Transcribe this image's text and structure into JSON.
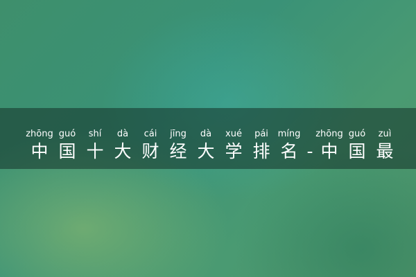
{
  "title": {
    "pinyin": [
      "zhōng",
      "guó",
      "shí",
      "dà",
      "cái",
      "jīng",
      "dà",
      "xué",
      "pái",
      "míng",
      "",
      "zhōng",
      "guó",
      "zuì"
    ],
    "chars": [
      "中",
      "国",
      "十",
      "大",
      "财",
      "经",
      "大",
      "学",
      "排",
      "名",
      "-",
      "中",
      "国",
      "最"
    ]
  },
  "colors": {
    "text": "#ffffff",
    "band": "#14322880"
  }
}
